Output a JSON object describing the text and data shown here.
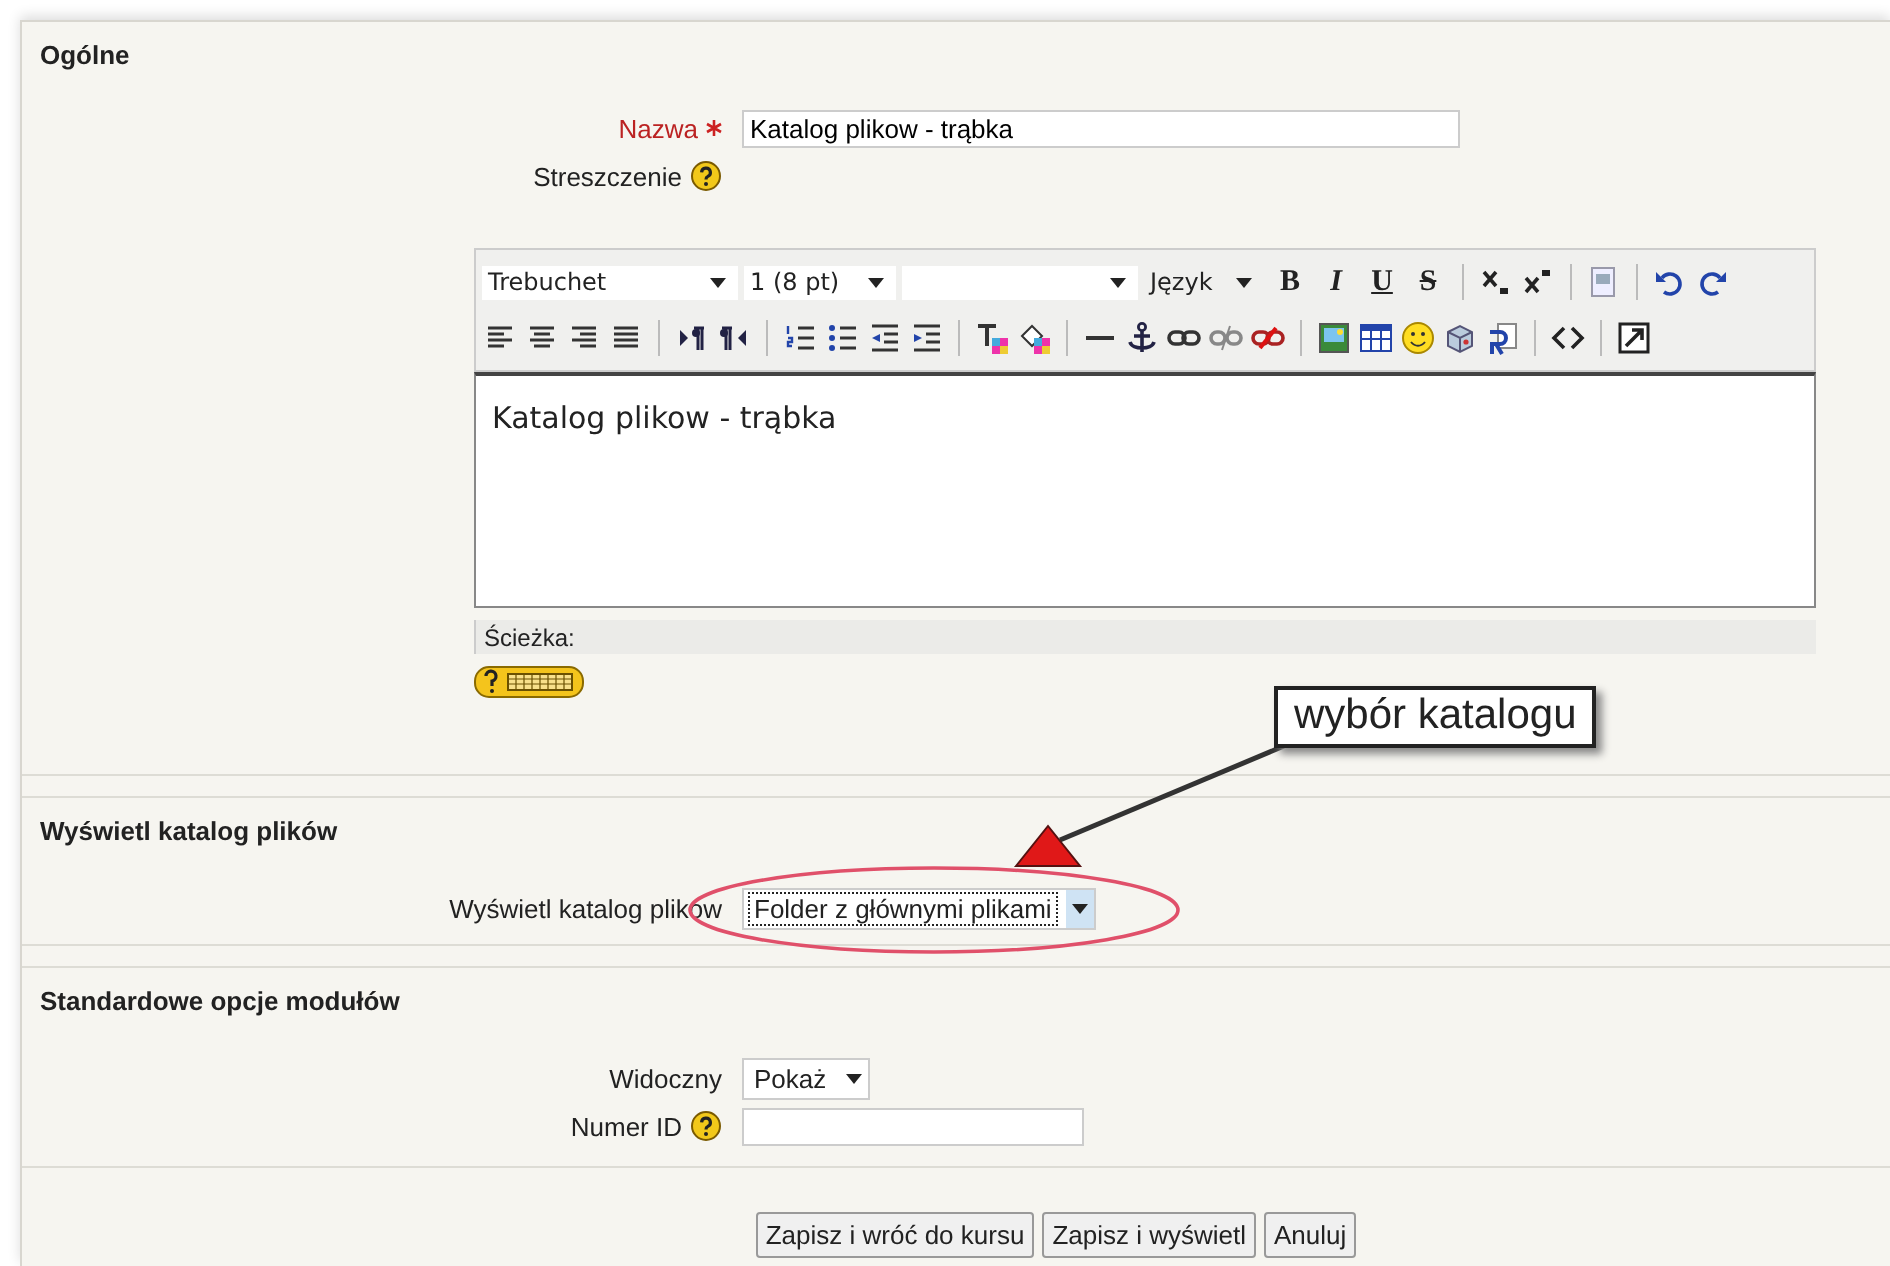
{
  "sections": [
    {
      "legend": "Ogólne",
      "fields": [
        {
          "kind": "text",
          "label": "Nazwa",
          "required": true,
          "help": false,
          "value": "Katalog plikow - trąbka"
        },
        {
          "kind": "label",
          "label": "Streszczenie",
          "required": false,
          "help": true
        }
      ],
      "editor": {
        "font": "Trebuchet",
        "size": "1 (8 pt)",
        "language": "Język",
        "format_buttons": [
          "B",
          "I",
          "U",
          "S"
        ],
        "content": "Katalog plikow - trąbka",
        "path_label": "Ścieżka:"
      }
    },
    {
      "legend": "Wyświetl katalog plików",
      "fields": [
        {
          "kind": "select",
          "label": "Wyświetl katalog plików",
          "required": false,
          "help": false,
          "value": "Folder z głównymi plikami",
          "focused": true
        }
      ]
    },
    {
      "legend": "Standardowe opcje modułów",
      "fields": [
        {
          "kind": "select",
          "label": "Widoczny",
          "required": false,
          "help": false,
          "value": "Pokaż",
          "focused": false
        },
        {
          "kind": "text",
          "label": "Numer ID",
          "required": false,
          "help": true
        }
      ]
    }
  ],
  "buttons": [
    "Zapisz i wróć do kursu",
    "Zapisz i wyświetl",
    "Anuluj"
  ],
  "callout": {
    "text": "wybór katalogu"
  }
}
